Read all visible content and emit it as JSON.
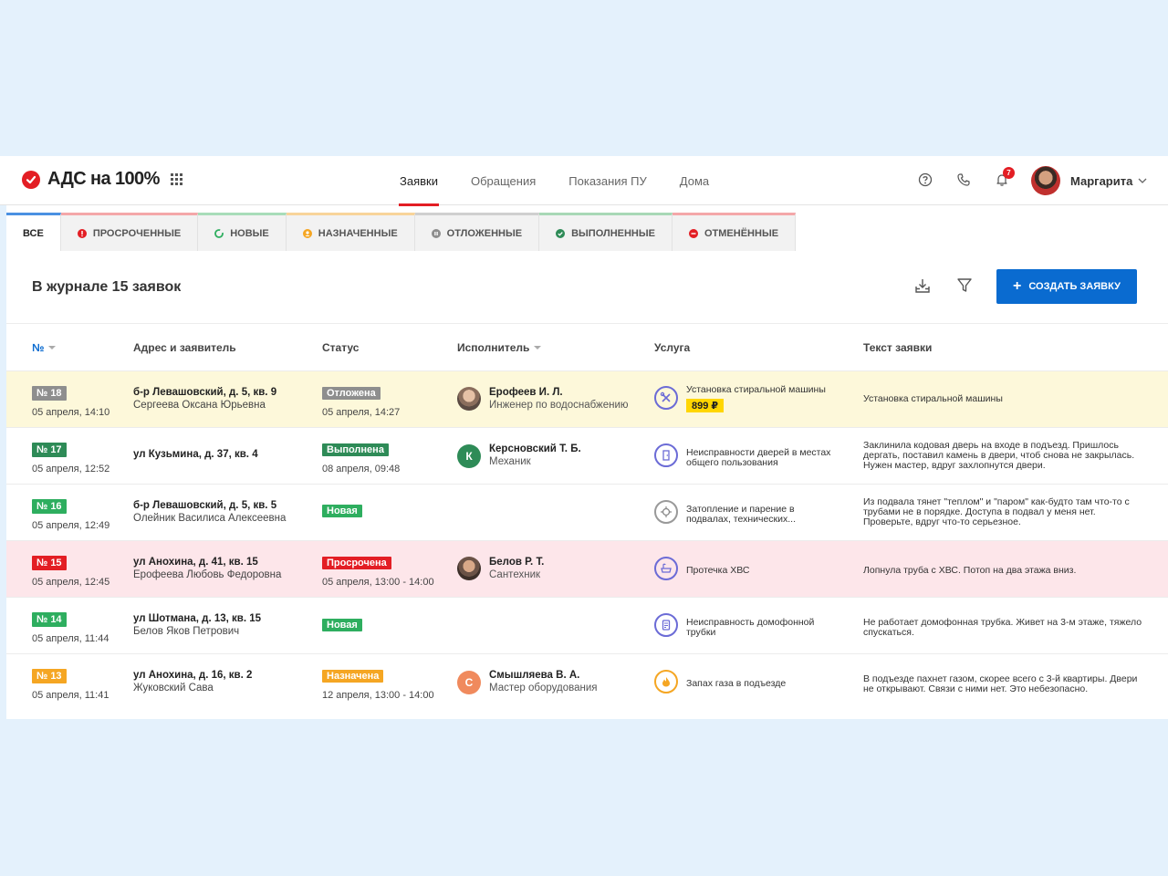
{
  "header": {
    "brand": "АДС на 100%",
    "nav": [
      "Заявки",
      "Обращения",
      "Показания ПУ",
      "Дома"
    ],
    "notifications_count": "7",
    "user_name": "Маргарита"
  },
  "tabs": [
    {
      "label": "ВСЕ",
      "color": "#4a90e2"
    },
    {
      "label": "ПРОСРОЧЕННЫЕ",
      "color": "#e31e24"
    },
    {
      "label": "НОВЫЕ",
      "color": "#2eae5f"
    },
    {
      "label": "НАЗНАЧЕННЫЕ",
      "color": "#f5a623"
    },
    {
      "label": "ОТЛОЖЕННЫЕ",
      "color": "#8e8e8e"
    },
    {
      "label": "ВЫПОЛНЕННЫЕ",
      "color": "#2e8b57"
    },
    {
      "label": "ОТМЕНЁННЫЕ",
      "color": "#e31e24"
    }
  ],
  "journal": {
    "title": "В журнале 15 заявок",
    "create_label": "СОЗДАТЬ ЗАЯВКУ"
  },
  "columns": [
    "№",
    "Адрес и заявитель",
    "Статус",
    "Исполнитель",
    "Услуга",
    "Текст заявки"
  ],
  "rows": [
    {
      "num": "№ 18",
      "num_color": "#8e8e8e",
      "date": "05 апреля",
      "time": "14:10",
      "address": "б-р Левашовский, д. 5, кв. 9",
      "applicant": "Сергеева Оксана Юрьевна",
      "status": "Отложена",
      "status_color": "#8e8e8e",
      "status_date": "05 апреля",
      "status_time": "14:27",
      "executor": "Ерофеев И. Л.",
      "role": "Инженер по водоснабжению",
      "avatar": "photo",
      "service": "Установка стиральной машины",
      "service_icon": "tools-icon",
      "price": "899 ₽",
      "text": "Установка стиральной машины",
      "bg": "#fdf8da"
    },
    {
      "num": "№ 17",
      "num_color": "#2e8b57",
      "date": "05 апреля",
      "time": "12:52",
      "address": "ул Кузьмина, д. 37, кв. 4",
      "applicant": "",
      "status": "Выполнена",
      "status_color": "#2e8b57",
      "status_date": "08 апреля",
      "status_time": "09:48",
      "executor": "Керсновский Т. Б.",
      "role": "Механик",
      "avatar": "К",
      "avatar_color": "#2e8b57",
      "service": "Неисправности дверей в местах общего пользования",
      "service_icon": "door-icon",
      "price": "",
      "text": "Заклинила кодовая дверь на входе в подъезд. Пришлось дергать, поставил камень в двери, чтоб снова не закрылась. Нужен мастер, вдруг захлопнутся двери.",
      "bg": "#ffffff"
    },
    {
      "num": "№ 16",
      "num_color": "#2eae5f",
      "date": "05 апреля",
      "time": "12:49",
      "address": "б-р Левашовский, д. 5, кв. 5",
      "applicant": "Олейник Василиса Алексеевна",
      "status": "Новая",
      "status_color": "#2eae5f",
      "status_date": "",
      "status_time": "",
      "executor": "",
      "role": "",
      "avatar": "",
      "service": "Затопление и парение в подвалах, технических...",
      "service_icon": "steam-icon",
      "price": "",
      "text": "Из подвала тянет \"теплом\" и \"паром\" как-будто там что-то с трубами не в порядке. Доступа в подвал у меня нет. Проверьте, вдруг что-то серьезное.",
      "bg": "#ffffff"
    },
    {
      "num": "№ 15",
      "num_color": "#e31e24",
      "date": "05 апреля",
      "time": "12:45",
      "address": "ул Анохина, д. 41, кв. 15",
      "applicant": "Ерофеева Любовь Федоровна",
      "status": "Просрочена",
      "status_color": "#e31e24",
      "status_date": "05 апреля",
      "status_time": "13:00 - 14:00",
      "executor": "Белов Р. Т.",
      "role": "Сантехник",
      "avatar": "photo",
      "service": "Протечка ХВС",
      "service_icon": "bath-icon",
      "price": "",
      "text": "Лопнула труба с ХВС. Потоп на два этажа вниз.",
      "bg": "#fde6ea"
    },
    {
      "num": "№ 14",
      "num_color": "#2eae5f",
      "date": "05 апреля",
      "time": "11:44",
      "address": "ул Шотмана, д. 13, кв. 15",
      "applicant": "Белов Яков Петрович",
      "status": "Новая",
      "status_color": "#2eae5f",
      "status_date": "",
      "status_time": "",
      "executor": "",
      "role": "",
      "avatar": "",
      "service": "Неисправность домофонной трубки",
      "service_icon": "intercom-icon",
      "price": "",
      "text": "Не работает домофонная трубка. Живет на 3-м этаже, тяжело спускаться.",
      "bg": "#ffffff"
    },
    {
      "num": "№ 13",
      "num_color": "#f5a623",
      "date": "05 апреля",
      "time": "11:41",
      "address": "ул Анохина, д. 16, кв. 2",
      "applicant": "Жуковский Сава",
      "status": "Назначена",
      "status_color": "#f5a623",
      "status_date": "12 апреля",
      "status_time": "13:00 - 14:00",
      "executor": "Смышляева В. А.",
      "role": "Мастер оборудования",
      "avatar": "С",
      "avatar_color": "#f08a5d",
      "service": "Запах газа в подъезде",
      "service_icon": "gas-flame-icon",
      "price": "",
      "text": "В подъезде пахнет газом, скорее всего с 3-й квартиры. Двери не открывают. Связи с ними нет. Это небезопасно.",
      "bg": "#ffffff"
    }
  ]
}
